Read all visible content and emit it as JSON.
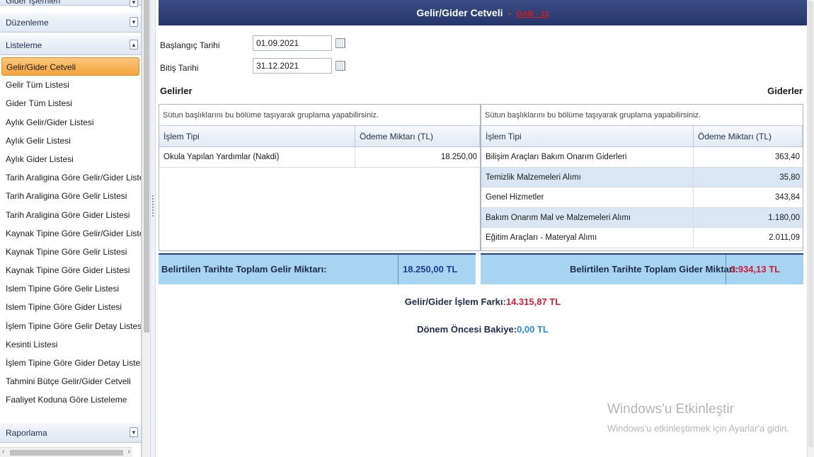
{
  "sidebar": {
    "sections": {
      "gider": "Gider İşlemleri",
      "duzenleme": "Düzenleme",
      "listeleme": "Listeleme",
      "raporlama": "Raporlama"
    },
    "items": [
      "Gelir/Gider Cetveli",
      "Gelir Tüm Listesi",
      "Gider Tüm Listesi",
      "Aylık Gelir/Gider Listesi",
      "Aylık Gelir Listesi",
      "Aylık Gider Listesi",
      "Tarih Araligina Göre Gelir/Gider Listesi",
      "Tarih Araligina Göre Gelir Listesi",
      "Tarih Araligina Göre Gider Listesi",
      "Kaynak Tipine Göre Gelir/Gider Listesi",
      "Kaynak Tipine Göre Gelir Listesi",
      "Kaynak Tipine Göre Gider Listesi",
      "Islem Tipine Göre Gelir Listesi",
      "Islem Tipine Göre Gider Listesi",
      "İşlem Tipine Göre Gelir Detay Listesi",
      "Kesinti Listesi",
      "İşlem Tipine Göre Gider Detay Listesi",
      "Tahmini Bütçe Gelir/Gider Cetveli",
      "Faaliyet Koduna Göre Listeleme"
    ],
    "active_index": 0
  },
  "header": {
    "title": "Gelir/Gider Cetveli",
    "separator": "-",
    "code": "OAB - 13"
  },
  "filters": {
    "start_label": "Başlangıç Tarihi",
    "start_value": "01.09.2021",
    "end_label": "Bitiş Tarihi",
    "end_value": "31.12.2021"
  },
  "gelirler": {
    "heading": "Gelirler",
    "group_hint": "Sütun başlıklarını bu bölüme taşıyarak gruplama yapabilirsiniz.",
    "columns": [
      "İşlem Tipi",
      "Ödeme Miktarı (TL)"
    ],
    "rows": [
      [
        "Okula Yapılan Yardımlar (Nakdi)",
        "18.250,00"
      ]
    ],
    "total_label": "Belirtilen Tarihte Toplam Gelir Miktarı:",
    "total_value": "18.250,00 TL"
  },
  "giderler": {
    "heading": "Giderler",
    "group_hint": "Sütun başlıklarını bu bölüme taşıyarak gruplama yapabilirsiniz.",
    "columns": [
      "İşlem Tipi",
      "Ödeme Miktarı (TL)"
    ],
    "rows": [
      [
        "Bilişim Araçları Bakım Onarım Giderleri",
        "363,40"
      ],
      [
        "Temizlik Malzemeleri Alımı",
        "35,80"
      ],
      [
        "Genel Hizmetler",
        "343,84"
      ],
      [
        "Bakım Onarım Mal ve Malzemeleri Alımı",
        "1.180,00"
      ],
      [
        "Eğitim Araçları - Materyal Alımı",
        "2.011,09"
      ]
    ],
    "total_label": "Belirtilen Tarihte Toplam Gider Miktarı:",
    "total_value": "3.934,13 TL"
  },
  "summary": {
    "diff_label": "Gelir/Gider İşlem Farkı:",
    "diff_value": "14.315,87 TL",
    "donem_label": "Dönem Öncesi Bakiye:",
    "donem_value": "0,00 TL"
  },
  "watermark": {
    "title": "Windows'u Etkinleştir",
    "subtitle": "Windows'u etkinleştirmek için Ayarlar'a gidin."
  },
  "icons": {
    "calendar": "calendar-icon",
    "collapse": "collapse-toggle-icon"
  }
}
